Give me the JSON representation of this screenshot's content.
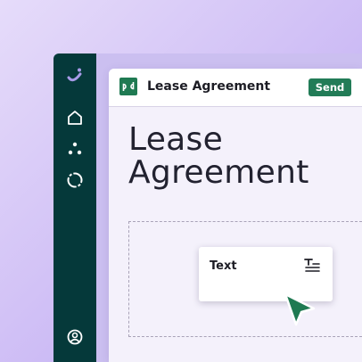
{
  "sidebar": {
    "icons": [
      "brand-smile-icon",
      "home-icon",
      "nodes-icon",
      "loop-icon",
      "account-icon"
    ]
  },
  "document": {
    "header_title": "Lease Agreement",
    "send_label": "Send",
    "title_line1": "Lease",
    "title_line2": "Agreement"
  },
  "field": {
    "label": "Text",
    "icon": "text-field-icon"
  },
  "colors": {
    "sidebar": "#05393a",
    "accent": "#227c57",
    "background_gradient": [
      "#e6dcfa",
      "#b7a2f0"
    ]
  }
}
